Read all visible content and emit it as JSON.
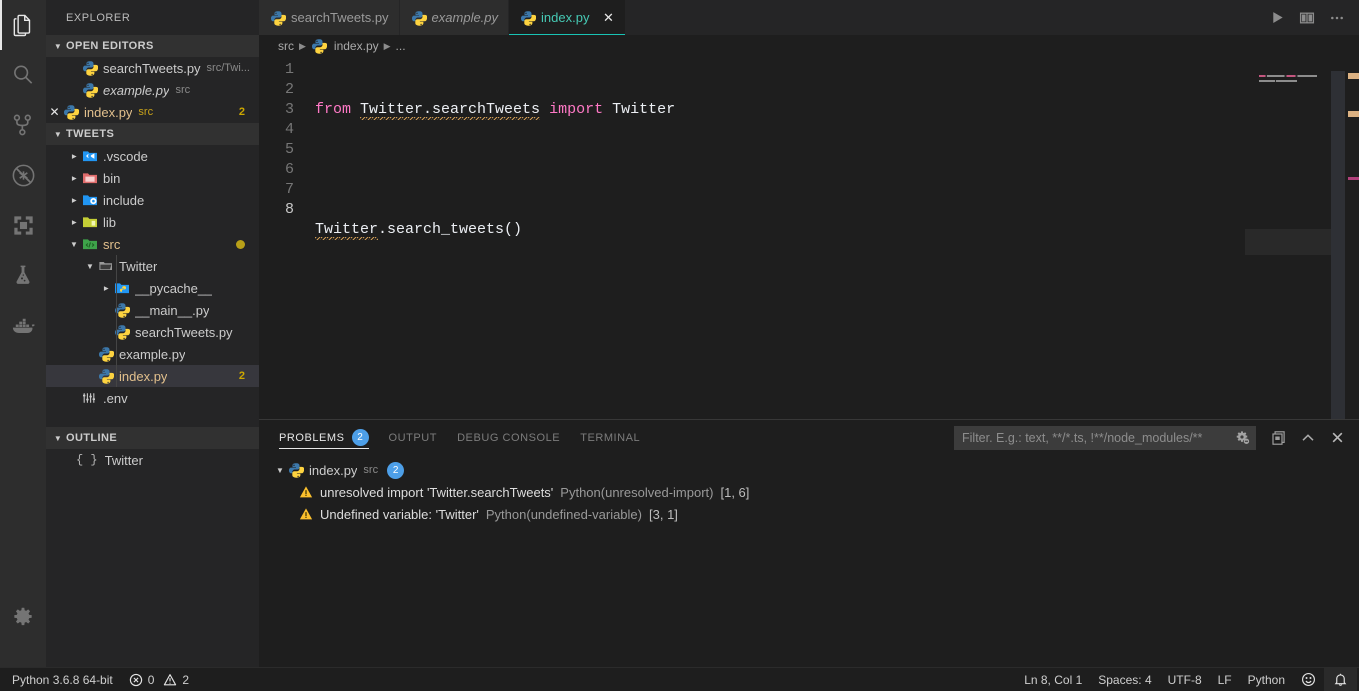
{
  "activitybar": {
    "items": [
      {
        "name": "explorer-icon",
        "title": "Explorer",
        "active": true
      },
      {
        "name": "search-icon",
        "title": "Search",
        "active": false
      },
      {
        "name": "source-control-icon",
        "title": "Source Control",
        "active": false
      },
      {
        "name": "run-and-debug-disabled-icon",
        "title": "Run and Debug",
        "active": false
      },
      {
        "name": "extensions-icon",
        "title": "Extensions",
        "active": false
      },
      {
        "name": "testing-flask-icon",
        "title": "Testing",
        "active": false
      },
      {
        "name": "docker-whale-icon",
        "title": "Docker",
        "active": false
      }
    ],
    "manage": {
      "name": "settings-gear-icon",
      "title": "Manage"
    }
  },
  "sidebar": {
    "title": "EXPLORER",
    "open_editors": {
      "header": "OPEN EDITORS",
      "items": [
        {
          "name": "searchTweets.py",
          "desc": "src/Twi...",
          "italic": false,
          "closable": false,
          "badge": ""
        },
        {
          "name": "example.py",
          "desc": "src",
          "italic": true,
          "closable": false,
          "badge": ""
        },
        {
          "name": "index.py",
          "desc": "src",
          "italic": false,
          "closable": true,
          "badge": "2"
        }
      ]
    },
    "workspace": {
      "header": "TWEETS",
      "items": [
        {
          "label": ".vscode",
          "type": "folder",
          "icon": "folder-vscode-icon",
          "depth": 1,
          "expanded": false,
          "modified": false,
          "badge": "",
          "dot": false
        },
        {
          "label": "bin",
          "type": "folder",
          "icon": "folder-bin-icon",
          "depth": 1,
          "expanded": false,
          "modified": false,
          "badge": "",
          "dot": false
        },
        {
          "label": "include",
          "type": "folder",
          "icon": "folder-include-icon",
          "depth": 1,
          "expanded": false,
          "modified": false,
          "badge": "",
          "dot": false
        },
        {
          "label": "lib",
          "type": "folder",
          "icon": "folder-lib-icon",
          "depth": 1,
          "expanded": false,
          "modified": false,
          "badge": "",
          "dot": false
        },
        {
          "label": "src",
          "type": "folder",
          "icon": "folder-src-icon",
          "depth": 1,
          "expanded": true,
          "modified": true,
          "badge": "",
          "dot": true
        },
        {
          "label": "Twitter",
          "type": "folder",
          "icon": "folder-open-icon",
          "depth": 2,
          "expanded": true,
          "modified": false,
          "badge": "",
          "dot": false
        },
        {
          "label": "__pycache__",
          "type": "folder",
          "icon": "folder-python-icon",
          "depth": 3,
          "expanded": false,
          "modified": false,
          "badge": "",
          "dot": false
        },
        {
          "label": "__main__.py",
          "type": "file",
          "icon": "python-file-icon",
          "depth": 3,
          "expanded": null,
          "modified": false,
          "badge": "",
          "dot": false
        },
        {
          "label": "searchTweets.py",
          "type": "file",
          "icon": "python-file-icon",
          "depth": 3,
          "expanded": null,
          "modified": false,
          "badge": "",
          "dot": false
        },
        {
          "label": "example.py",
          "type": "file",
          "icon": "python-file-icon",
          "depth": 2,
          "expanded": null,
          "modified": false,
          "badge": "",
          "dot": false
        },
        {
          "label": "index.py",
          "type": "file",
          "icon": "python-file-icon",
          "depth": 2,
          "expanded": null,
          "modified": true,
          "badge": "2",
          "dot": false,
          "selected": true
        },
        {
          "label": ".env",
          "type": "file",
          "icon": "env-file-icon",
          "depth": 1,
          "expanded": null,
          "modified": false,
          "badge": "",
          "dot": false
        }
      ]
    },
    "outline": {
      "header": "OUTLINE",
      "items": [
        {
          "label": "Twitter",
          "symbol": "{ }"
        }
      ]
    }
  },
  "editor": {
    "tabs": [
      {
        "label": "searchTweets.py",
        "active": false,
        "italic": false,
        "closable": false
      },
      {
        "label": "example.py",
        "active": false,
        "italic": true,
        "closable": false
      },
      {
        "label": "index.py",
        "active": true,
        "italic": false,
        "closable": true
      }
    ],
    "tab_actions": [
      {
        "name": "run-python-file-icon",
        "label": "Run"
      },
      {
        "name": "split-editor-icon",
        "label": "Split Editor"
      },
      {
        "name": "more-actions-icon",
        "label": "More Actions..."
      }
    ],
    "breadcrumbs": [
      "src",
      "index.py",
      "..."
    ],
    "line_numbers": [
      "1",
      "2",
      "3",
      "4",
      "5",
      "6",
      "7",
      "8"
    ],
    "active_line": 8,
    "code_lines": [
      {
        "n": 1,
        "tokens": [
          {
            "t": "from",
            "c": "kw"
          },
          {
            "t": " ",
            "c": "plain"
          },
          {
            "t": "Twitter.searchTweets",
            "c": "plain squig"
          },
          {
            "t": " ",
            "c": "plain"
          },
          {
            "t": "import",
            "c": "kw"
          },
          {
            "t": " ",
            "c": "plain"
          },
          {
            "t": "Twitter",
            "c": "plain"
          }
        ]
      },
      {
        "n": 2,
        "tokens": []
      },
      {
        "n": 3,
        "tokens": [
          {
            "t": "Twitter",
            "c": "plain squig"
          },
          {
            "t": ".search_tweets()",
            "c": "plain"
          }
        ]
      },
      {
        "n": 4,
        "tokens": []
      },
      {
        "n": 5,
        "tokens": []
      },
      {
        "n": 6,
        "tokens": []
      },
      {
        "n": 7,
        "tokens": []
      },
      {
        "n": 8,
        "tokens": []
      }
    ],
    "colors": {
      "keyword": "#ff79c6",
      "text": "#eceff4",
      "squiggle": "#cc9a54",
      "cursor": "#ff5874",
      "active_tab_underline": "#19c3b4",
      "background": "#1e1e1e"
    }
  },
  "panel": {
    "tabs": [
      {
        "label": "PROBLEMS",
        "badge": "2",
        "active": true
      },
      {
        "label": "OUTPUT",
        "badge": "",
        "active": false
      },
      {
        "label": "DEBUG CONSOLE",
        "badge": "",
        "active": false
      },
      {
        "label": "TERMINAL",
        "badge": "",
        "active": false
      }
    ],
    "filter": {
      "value": "",
      "placeholder": "Filter. E.g.: text, **/*.ts, !**/node_modules/**"
    },
    "filter_icon": "filter-settings-icon",
    "actions": [
      {
        "name": "view-as-table-icon",
        "label": "View as Table"
      },
      {
        "name": "chevron-up-icon",
        "label": "Maximize Panel Size"
      },
      {
        "name": "close-panel-icon",
        "label": "Close Panel"
      }
    ],
    "problems": {
      "file": {
        "name": "index.py",
        "path": "src",
        "count": "2"
      },
      "items": [
        {
          "severity": "warning",
          "message": "unresolved import 'Twitter.searchTweets'",
          "source": "Python(unresolved-import)",
          "position": "[1, 6]"
        },
        {
          "severity": "warning",
          "message": "Undefined variable: 'Twitter'",
          "source": "Python(undefined-variable)",
          "position": "[3, 1]"
        }
      ]
    }
  },
  "statusbar": {
    "left": [
      {
        "name": "python-interpreter",
        "label": "Python 3.6.8 64-bit"
      },
      {
        "name": "problems-counts",
        "errors": "0",
        "warnings": "2"
      }
    ],
    "right": [
      {
        "name": "cursor-position",
        "label": "Ln 8, Col 1"
      },
      {
        "name": "indentation",
        "label": "Spaces: 4"
      },
      {
        "name": "encoding",
        "label": "UTF-8"
      },
      {
        "name": "eol",
        "label": "LF"
      },
      {
        "name": "language-mode",
        "label": "Python"
      },
      {
        "name": "feedback-smiley",
        "label": "☺"
      },
      {
        "name": "notifications-bell",
        "label": "🔔"
      }
    ]
  }
}
